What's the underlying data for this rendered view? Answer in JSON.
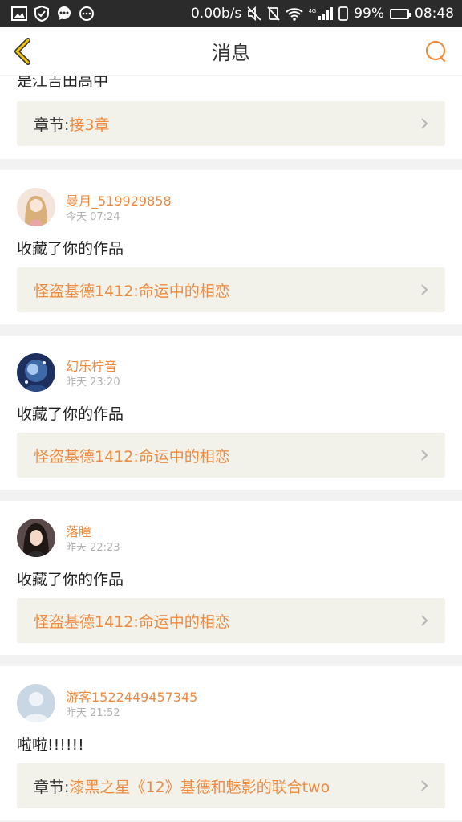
{
  "colors": {
    "accent": "#ef8a3e",
    "status_bar": "#2b2b2b",
    "ref_bg": "#f2f2ea"
  },
  "status_bar": {
    "icons_left": [
      "image-icon",
      "shield-icon",
      "chat-icon",
      "more-icon"
    ],
    "speed": "0.00b/s",
    "network_label": "4G",
    "battery": "99%",
    "battery_level": 0.99,
    "time": "08:48"
  },
  "nav": {
    "title": "消息",
    "back_icon": "chevron-left-icon",
    "action_icon": "chat-bubble-icon"
  },
  "partial": {
    "text": "是江吉田高中",
    "ref_prefix": "章节:",
    "ref_title": "接3章"
  },
  "messages": [
    {
      "user": "曼月_519929858",
      "time": "今天 07:24",
      "action": "收藏了你的作品",
      "ref_prefix": "",
      "ref_title": "怪盗基德1412:命运中的相恋"
    },
    {
      "user": "幻乐柠音",
      "time": "昨天 23:20",
      "action": "收藏了你的作品",
      "ref_prefix": "",
      "ref_title": "怪盗基德1412:命运中的相恋"
    },
    {
      "user": "落瞳",
      "time": "昨天 22:23",
      "action": "收藏了你的作品",
      "ref_prefix": "",
      "ref_title": "怪盗基德1412:命运中的相恋"
    },
    {
      "user": "游客1522449457345",
      "time": "昨天 21:52",
      "action": "啦啦!!!!!!",
      "ref_prefix": "章节:",
      "ref_title": "漆黑之星《12》基德和魅影的联合two"
    }
  ]
}
